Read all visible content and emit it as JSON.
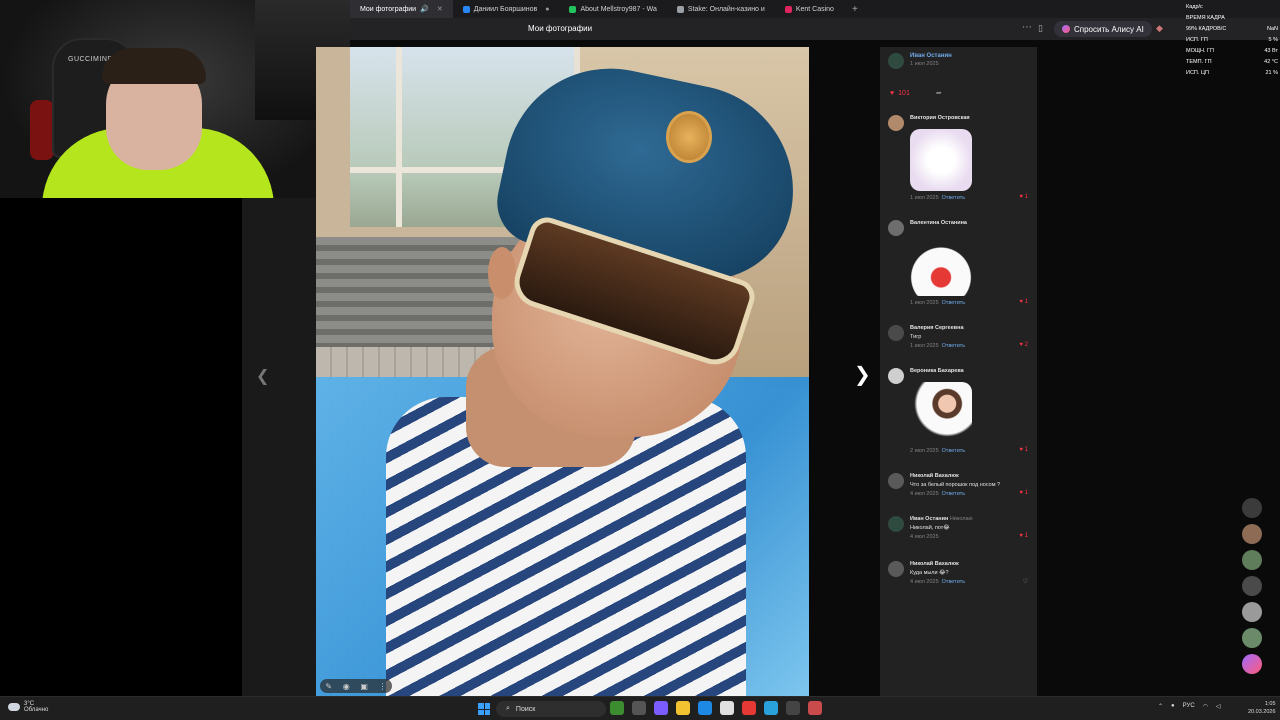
{
  "browser": {
    "tabs": [
      {
        "label": "Мои фотографии",
        "active": true,
        "color": "#ffffff"
      },
      {
        "label": "Даниил Бояршинов",
        "active": false,
        "color": "#2787f5"
      },
      {
        "label": "About Mellstroy987 - Wa",
        "active": false,
        "color": "#21c45c"
      },
      {
        "label": "Stake: Онлайн-казино и",
        "active": false,
        "color": "#9aa0a6"
      },
      {
        "label": "Kent Casino",
        "active": false,
        "color": "#e0245e"
      }
    ],
    "page_title": "Мои фотографии",
    "alice_button": "Спросить Алису AI"
  },
  "hwmon": {
    "rows": [
      {
        "label": "Кадр/с",
        "value": ""
      },
      {
        "label": "ВРЕМЯ КАДРА",
        "value": ""
      },
      {
        "label": "99% КАДРОВ/С",
        "value": "NaN"
      },
      {
        "label": "ИСП. ГП",
        "value": "5 %"
      },
      {
        "label": "МОЩН. ГП",
        "value": "43 Вт"
      },
      {
        "label": "ТЕМП. ГП",
        "value": "42 °C"
      },
      {
        "label": "ИСП. ЦП",
        "value": "21 %"
      }
    ]
  },
  "post": {
    "author": "Иван Останин",
    "date": "1 июл 2025",
    "likes": "101"
  },
  "comments": [
    {
      "name": "Виктория Островская",
      "text": "",
      "date": "1 июл 2025",
      "reply": "Ответить",
      "likes": "1",
      "sticker": true,
      "avatar": "#b08a6a",
      "sticker_color": "#f0e6f2"
    },
    {
      "name": "Валентина Останина",
      "text": "",
      "date": "1 июл 2025",
      "reply": "Ответить",
      "likes": "1",
      "sticker": true,
      "avatar": "#6d6d6d",
      "sticker_color": "#f2f2f2"
    },
    {
      "name": "Валерия Сергеевна",
      "text": "Тигр",
      "date": "1 июл 2025",
      "reply": "Ответить",
      "likes": "2",
      "sticker": false,
      "avatar": "#4a4a4a"
    },
    {
      "name": "Вероника Бахарева",
      "text": "",
      "date": "2 июл 2025",
      "reply": "Ответить",
      "likes": "1",
      "sticker": true,
      "avatar": "#cfcfcf",
      "sticker_color": "#e8d6cf"
    },
    {
      "name": "Николай Вахалюк",
      "text": "Что за белый порошок под носом ?",
      "date": "4 июл 2025",
      "reply": "Ответить",
      "likes": "1",
      "sticker": false,
      "avatar": "#5a5a5a"
    },
    {
      "name": "Иван Останин",
      "text": "Николай, пот😂",
      "date": "4 июл 2025",
      "reply": "",
      "likes": "1",
      "sticker": false,
      "avatar": "#2f4a3f",
      "replying_to": "Николаю"
    },
    {
      "name": "Николай Вахалюк",
      "text": "Куда мыли 😂?",
      "date": "4 июл 2025",
      "reply": "Ответить",
      "likes": "",
      "sticker": false,
      "avatar": "#5a5a5a"
    }
  ],
  "webcam": {
    "logo": "GUCCIMIND"
  },
  "taskbar": {
    "weather_temp": "3°C",
    "weather_desc": "Облачно",
    "search_label": "Поиск",
    "lang": "РУС",
    "time": "1:05",
    "date": "20.03.2026"
  }
}
